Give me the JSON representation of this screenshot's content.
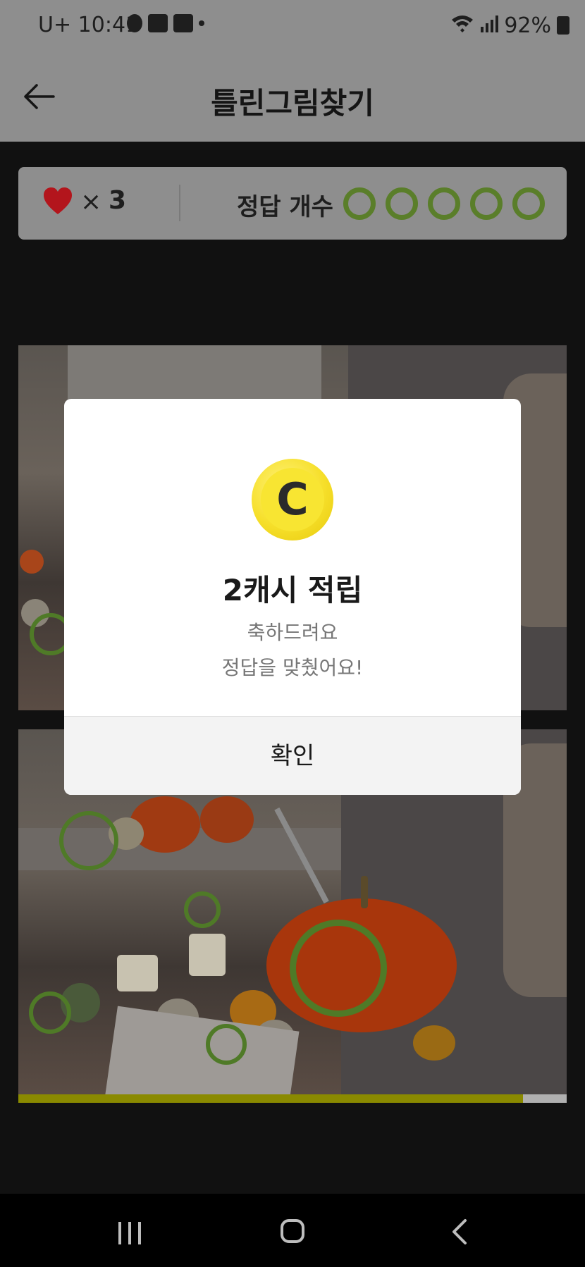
{
  "status_bar": {
    "carrier": "U+",
    "time": "10:41",
    "battery": "92%"
  },
  "header": {
    "title": "틀린그림찾기"
  },
  "score": {
    "lives_symbol": "×",
    "lives": "3",
    "answers_label": "정답 개수",
    "answers_total": 5
  },
  "game": {
    "progress_fraction": 0.92
  },
  "modal": {
    "title": "2캐시 적립",
    "message_line1": "축하드려요",
    "message_line2": "정답을 맞췄어요!",
    "confirm_label": "확인",
    "coin_letter": "C"
  },
  "colors": {
    "accent_green": "#5a7e2a",
    "heart_red": "#b3151c",
    "coin_yellow": "#f6df2a"
  }
}
